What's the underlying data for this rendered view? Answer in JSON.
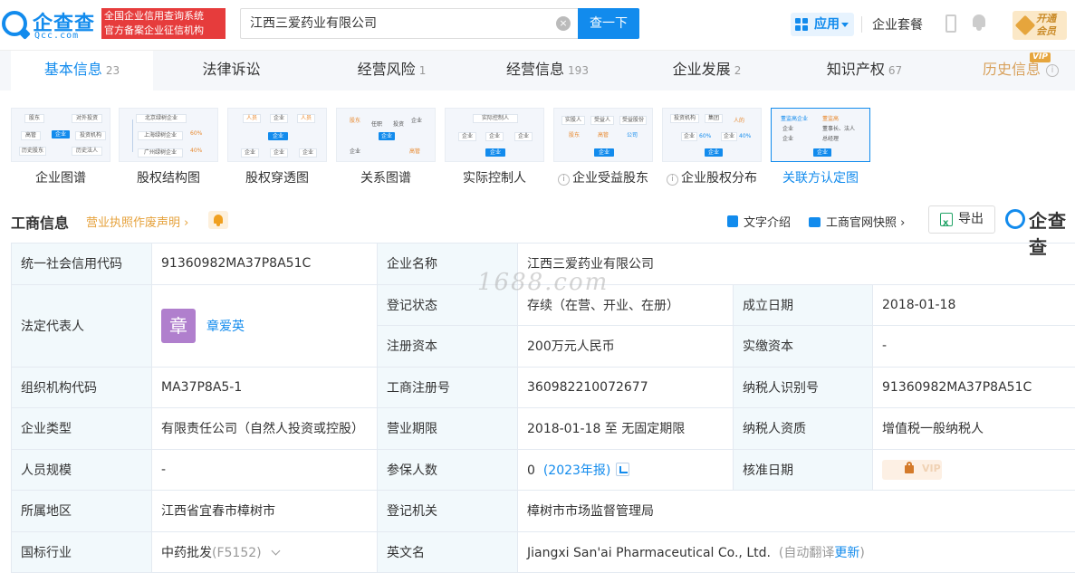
{
  "header": {
    "logo_text": "企查查",
    "logo_sub": "Qcc.com",
    "slogan_line1": "全国企业信用查询系统",
    "slogan_line2": "官方备案企业征信机构",
    "search_value": "江西三爱药业有限公司",
    "search_button": "查一下",
    "app_label": "应用",
    "package_label": "企业套餐",
    "vip_line1": "开通",
    "vip_line2": "会员"
  },
  "tabs": [
    {
      "label": "基本信息",
      "count": "23"
    },
    {
      "label": "法律诉讼",
      "count": ""
    },
    {
      "label": "经营风险",
      "count": "1"
    },
    {
      "label": "经营信息",
      "count": "193"
    },
    {
      "label": "企业发展",
      "count": "2"
    },
    {
      "label": "知识产权",
      "count": "67"
    },
    {
      "label": "历史信息",
      "count": "",
      "tag": "VIP"
    }
  ],
  "graphs": [
    {
      "label": "企业图谱",
      "thumb": [
        "股东",
        "对外投资",
        "高管",
        "企业",
        "投资机构",
        "历史股东",
        "历史法人"
      ]
    },
    {
      "label": "股权结构图",
      "thumb": [
        "北京绿树企业",
        "上海绿树企业",
        "广州绿树企业",
        "60%",
        "40%",
        "40%"
      ]
    },
    {
      "label": "股权穿透图",
      "thumb": [
        "人员",
        "企业",
        "人员",
        "企业",
        "企业",
        "企业",
        "企业"
      ]
    },
    {
      "label": "关系图谱",
      "thumb": [
        "股东",
        "任职",
        "投资",
        "企业",
        "企业",
        "企业",
        "高管"
      ]
    },
    {
      "label": "实际控制人",
      "thumb": [
        "实际控制人",
        "企业",
        "企业",
        "企业",
        "企业"
      ]
    },
    {
      "label": "企业受益股东",
      "thumb": [
        "实股人",
        "受益人",
        "受益股份",
        "股东",
        "高管",
        "公司",
        "企业"
      ]
    },
    {
      "label": "企业股权分布",
      "thumb": [
        "投资机构",
        "集团",
        "人的",
        "企业",
        "60%",
        "企业",
        "40%",
        "企业"
      ]
    },
    {
      "label": "关联方认定图",
      "thumb": [
        "董监高企业",
        "董监高",
        "企业",
        "董事长、法人",
        "企业",
        "总经理",
        "企业"
      ]
    }
  ],
  "section": {
    "title": "工商信息",
    "notice_link": "营业执照作废声明",
    "text_intro": "文字介绍",
    "snapshot": "工商官网快照",
    "export": "导出",
    "brand": "企查查"
  },
  "table": {
    "credit_code_label": "统一社会信用代码",
    "credit_code": "91360982MA37P8A51C",
    "company_name_label": "企业名称",
    "company_name": "江西三爱药业有限公司",
    "legal_rep_label": "法定代表人",
    "legal_rep_avatar": "章",
    "legal_rep": "章爱英",
    "reg_status_label": "登记状态",
    "reg_status": "存续（在营、开业、在册）",
    "established_label": "成立日期",
    "established": "2018-01-18",
    "reg_capital_label": "注册资本",
    "reg_capital": "200万元人民币",
    "paid_capital_label": "实缴资本",
    "paid_capital": "-",
    "org_code_label": "组织机构代码",
    "org_code": "MA37P8A5-1",
    "reg_no_label": "工商注册号",
    "reg_no": "360982210072677",
    "taxpayer_id_label": "纳税人识别号",
    "taxpayer_id": "91360982MA37P8A51C",
    "company_type_label": "企业类型",
    "company_type": "有限责任公司（自然人投资或控股）",
    "term_label": "营业期限",
    "term": "2018-01-18 至 无固定期限",
    "taxpayer_type_label": "纳税人资质",
    "taxpayer_type": "增值税一般纳税人",
    "staff_label": "人员规模",
    "staff": "-",
    "insured_label": "参保人数",
    "insured": "0",
    "insured_year": "(2023年报)",
    "approve_label": "核准日期",
    "approve_vip": "VIP",
    "region_label": "所属地区",
    "region": "江西省宜春市樟树市",
    "authority_label": "登记机关",
    "authority": "樟树市市场监督管理局",
    "industry_label": "国标行业",
    "industry": "中药批发",
    "industry_code": "(F5152)",
    "english_label": "英文名",
    "english": "Jiangxi San'ai Pharmaceutical Co., Ltd.",
    "english_note_prefix": "(自动翻译",
    "english_update": "更新",
    "english_note_suffix": ")"
  },
  "watermark": "1688.com"
}
